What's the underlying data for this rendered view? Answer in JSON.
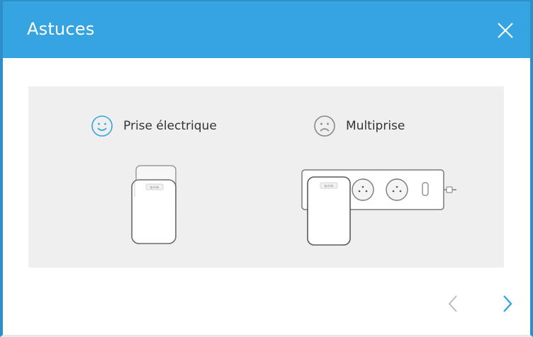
{
  "dialog": {
    "title": "Astuces",
    "close_icon": "close-icon"
  },
  "tips": [
    {
      "label": "Prise électrique",
      "icon": "happy-face-icon",
      "icon_color": "#35a4e0"
    },
    {
      "label": "Multiprise",
      "icon": "sad-face-icon",
      "icon_color": "#888888"
    }
  ],
  "navigation": {
    "prev_icon": "chevron-left-icon",
    "next_icon": "chevron-right-icon",
    "prev_color": "#bdbdbd",
    "next_color": "#35a4e0"
  },
  "colors": {
    "header": "#35a4e0",
    "panel": "#efefef"
  }
}
